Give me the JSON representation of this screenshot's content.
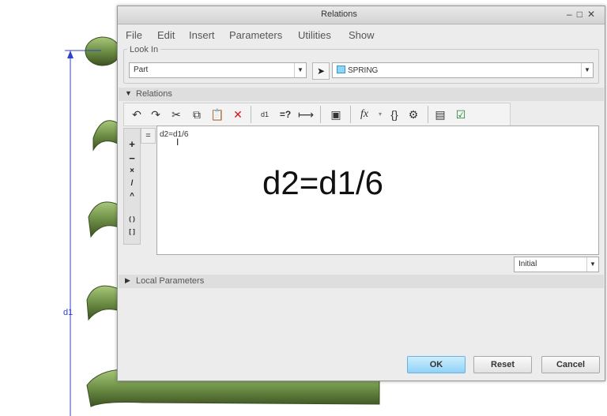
{
  "background": {
    "dimension_label": "d1",
    "spring_color": "#6d8f46",
    "dimension_color": "#3341c8"
  },
  "dialog": {
    "title": "Relations",
    "menu": [
      "File",
      "Edit",
      "Insert",
      "Parameters",
      "Utilities",
      "Show"
    ],
    "look_in": {
      "label": "Look In",
      "type_value": "Part",
      "model_value": "SPRING"
    },
    "relations_section": {
      "label": "Relations",
      "expanded": true
    },
    "toolbar_icons": [
      "undo-icon",
      "redo-icon",
      "cut-icon",
      "copy-icon",
      "paste-icon",
      "delete-icon",
      "display-values-icon",
      "evaluate-icon",
      "unit-sensitive-icon",
      "verify-icon",
      "function-icon",
      "parameters-icon",
      "sort-icon",
      "insert-from-file-icon",
      "verify-relations-icon"
    ],
    "operators": [
      "+",
      "−",
      "×",
      "/",
      "^",
      "( )",
      "[ ]"
    ],
    "equals_label": "=",
    "editor": {
      "content": "d2=d1/6",
      "overlay_text": "d2=d1/6"
    },
    "state_select": "Initial",
    "local_parameters": {
      "label": "Local Parameters",
      "expanded": false
    },
    "buttons": {
      "ok": "OK",
      "reset": "Reset",
      "cancel": "Cancel"
    }
  }
}
